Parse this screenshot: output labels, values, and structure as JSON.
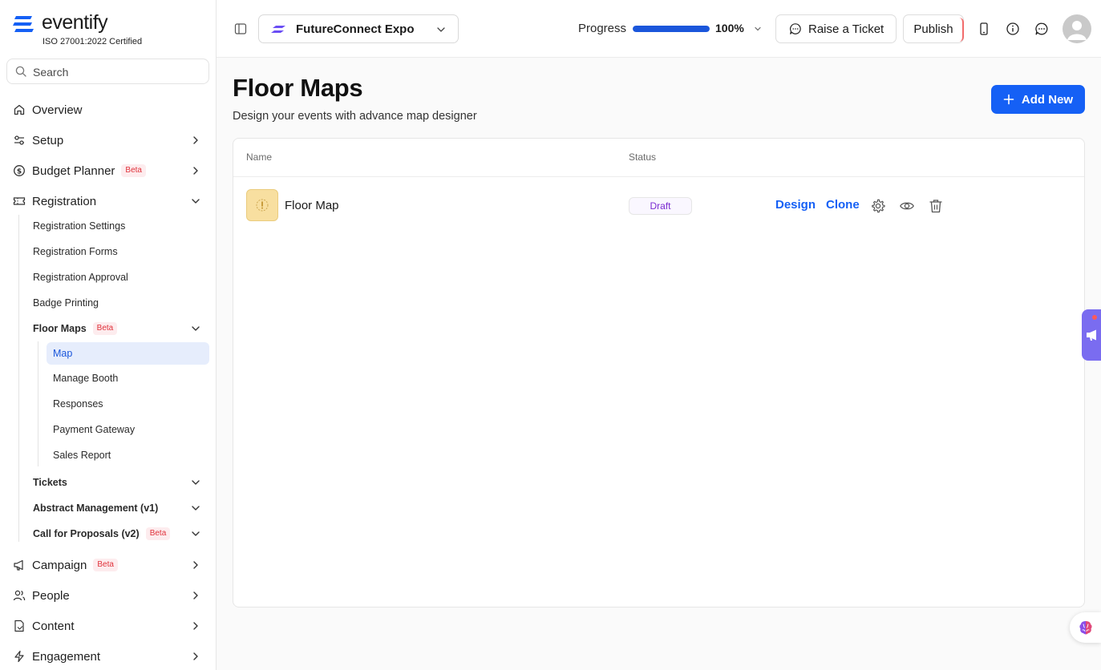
{
  "brand": {
    "name": "eventify",
    "certification": "ISO 27001:2022 Certified"
  },
  "search": {
    "placeholder": "Search"
  },
  "sidebar": {
    "items": [
      {
        "label": "Overview",
        "icon": "home-icon"
      },
      {
        "label": "Setup",
        "icon": "sliders-icon"
      },
      {
        "label": "Budget Planner",
        "badge": "Beta",
        "icon": "dollar-icon"
      },
      {
        "label": "Registration",
        "icon": "ticket-icon"
      },
      {
        "label": "Campaign",
        "badge": "Beta",
        "icon": "megaphone-icon"
      },
      {
        "label": "People",
        "icon": "people-icon"
      },
      {
        "label": "Content",
        "icon": "document-icon"
      },
      {
        "label": "Engagement",
        "icon": "bolt-icon"
      }
    ],
    "registration_children": [
      {
        "label": "Registration Settings"
      },
      {
        "label": "Registration Forms"
      },
      {
        "label": "Registration Approval"
      },
      {
        "label": "Badge Printing"
      },
      {
        "label": "Floor Maps",
        "badge": "Beta"
      },
      {
        "label": "Tickets"
      },
      {
        "label": "Abstract Management (v1)"
      },
      {
        "label": "Call for Proposals (v2)",
        "badge": "Beta"
      }
    ],
    "floor_maps_children": [
      {
        "label": "Map",
        "active": true
      },
      {
        "label": "Manage Booth"
      },
      {
        "label": "Responses"
      },
      {
        "label": "Payment Gateway"
      },
      {
        "label": "Sales Report"
      }
    ]
  },
  "header": {
    "event_name": "FutureConnect Expo",
    "progress_label": "Progress",
    "progress_value": "100%",
    "progress_fraction": 1.0,
    "raise_ticket_label": "Raise a Ticket",
    "publish_label": "Publish"
  },
  "main": {
    "title": "Floor Maps",
    "subtitle": "Design your events with advance map designer",
    "add_new_label": "Add New",
    "table": {
      "columns": [
        "Name",
        "Status"
      ],
      "rows": [
        {
          "name": "Floor Map",
          "status": "Draft",
          "actions": [
            "Design",
            "Clone"
          ]
        }
      ]
    }
  },
  "colors": {
    "accent": "#1560f5",
    "active_bg": "#e6edfc",
    "beta_text": "#e0323b",
    "draft_text": "#7b2cd1",
    "widget": "#7a6cf0"
  }
}
